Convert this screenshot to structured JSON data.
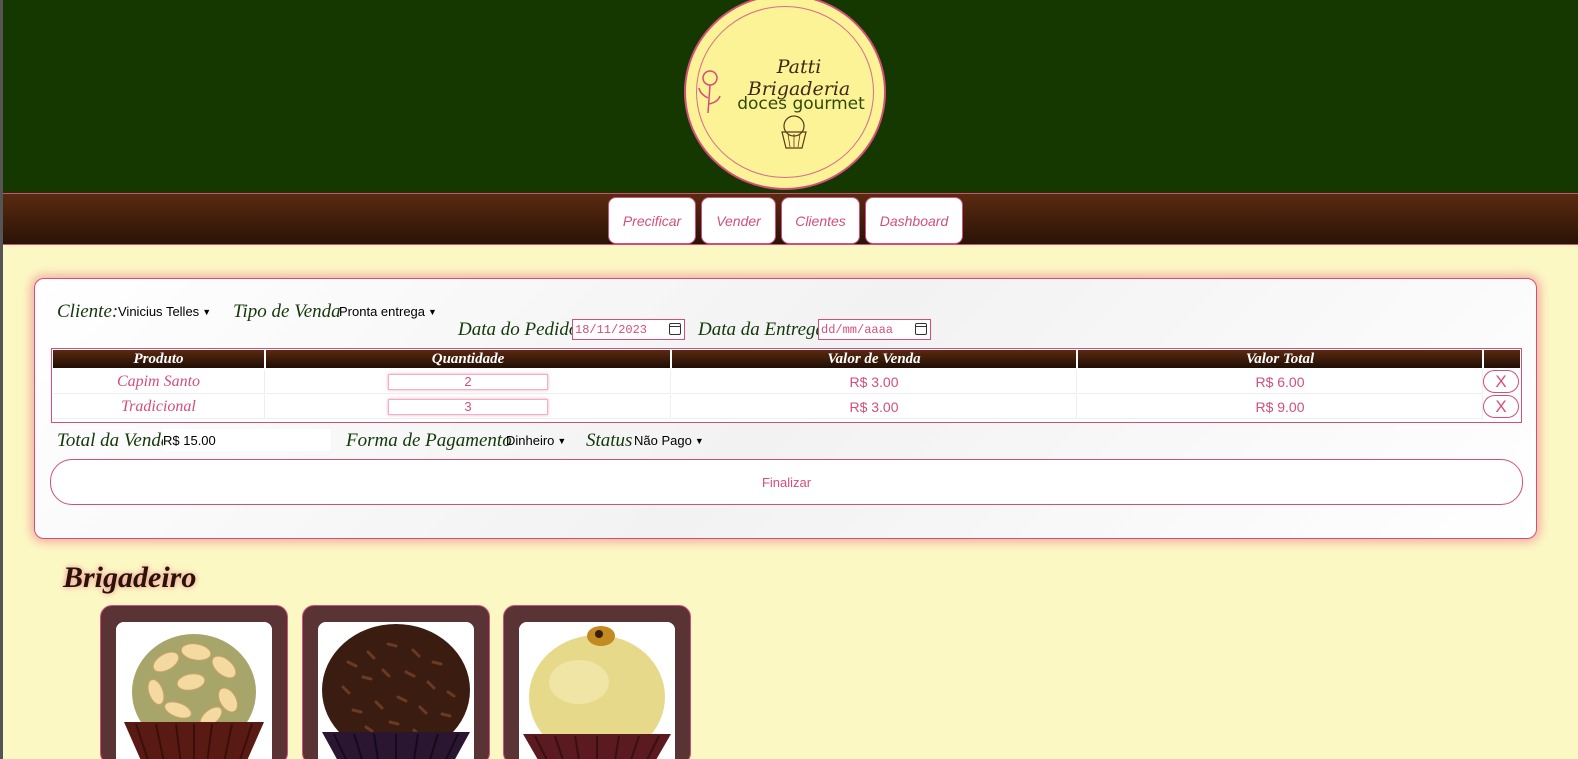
{
  "header": {
    "logo": {
      "name": "Patti Brigaderia",
      "tagline": "doces gourmet"
    }
  },
  "nav": {
    "items": [
      {
        "label": "Precificar"
      },
      {
        "label": "Vender"
      },
      {
        "label": "Clientes"
      },
      {
        "label": "Dashboard"
      }
    ]
  },
  "sale": {
    "client_label": "Cliente:",
    "client_value": "Vinicius Telles",
    "sale_type_label": "Tipo de Venda",
    "sale_type_value": "Pronta entrega",
    "order_date_label": "Data do Pedido",
    "order_date_value": "18/11/2023",
    "delivery_date_label": "Data da Entrega",
    "delivery_date_placeholder": "dd/mm/aaaa",
    "table": {
      "headers": [
        "Produto",
        "Quantidade",
        "Valor de Venda",
        "Valor Total"
      ],
      "rows": [
        {
          "product": "Capim Santo",
          "quantity": "2",
          "unit_price": "R$ 3.00",
          "total": "R$ 6.00",
          "delete_label": "X"
        },
        {
          "product": "Tradicional",
          "quantity": "3",
          "unit_price": "R$ 3.00",
          "total": "R$ 9.00",
          "delete_label": "X"
        }
      ]
    },
    "total_label": "Total da Venda",
    "total_value": "R$ 15.00",
    "payment_label": "Forma de Pagamento",
    "payment_value": "Dinheiro",
    "status_label": "Status",
    "status_value": "Não Pago",
    "finish_label": "Finalizar"
  },
  "category": {
    "title": "Brigadeiro",
    "products": [
      {
        "image": "almond-brigadeiro"
      },
      {
        "image": "chocolate-sprinkle-brigadeiro"
      },
      {
        "image": "passion-fruit-brigadeiro"
      }
    ]
  },
  "colors": {
    "header_bg": "#143800",
    "nav_bg": "#3d1c08",
    "page_bg": "#fcf8c4",
    "accent": "#d34e7c",
    "logo_bg": "#fcf296"
  }
}
